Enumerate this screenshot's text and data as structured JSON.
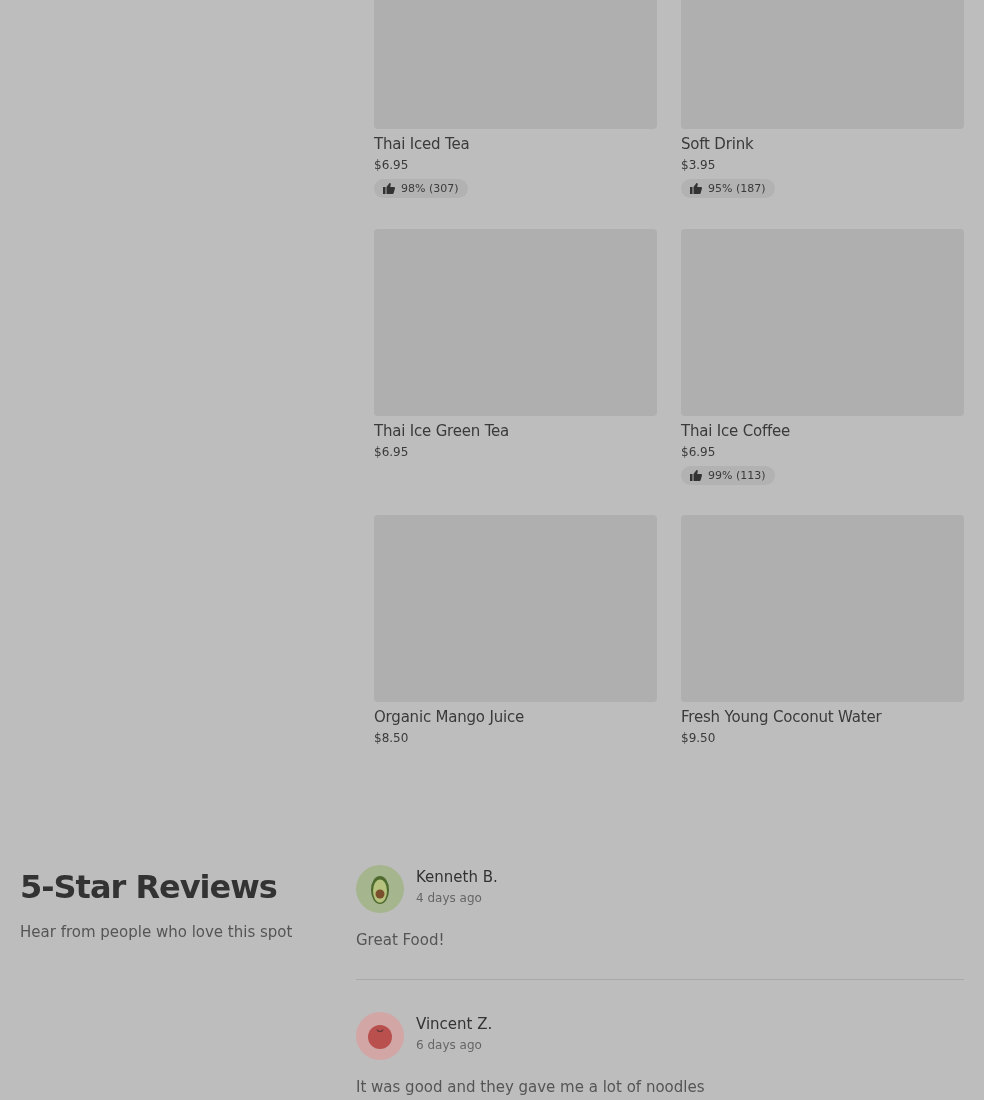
{
  "menu_items": [
    {
      "kind": "picture",
      "name": "Thai Iced Tea",
      "price": "$6.95",
      "rating": "98% (307)"
    },
    {
      "kind": "picture",
      "name": "Soft Drink",
      "price": "$3.95",
      "rating": "95% (187)"
    },
    {
      "kind": "picture",
      "name": "Thai Ice Green Tea",
      "price": "$6.95"
    },
    {
      "kind": "picture",
      "name": "Thai Ice Coffee",
      "price": "$6.95",
      "rating": "99% (113)"
    },
    {
      "kind": "picture",
      "name": "Organic Mango Juice",
      "price": "$8.50"
    },
    {
      "kind": "picture",
      "name": "Fresh Young Coconut Water",
      "price": "$9.50"
    }
  ],
  "reviews_section": {
    "title": "5-Star Reviews",
    "subtitle": "Hear from people who love this spot"
  },
  "reviews": [
    {
      "kind": "avocado",
      "name": "Kenneth B.",
      "time": "4 days ago",
      "text": "Great Food!"
    },
    {
      "kind": "tomato",
      "name": "Vincent Z.",
      "time": "6 days ago",
      "text": "It was good and they gave me a lot of noodles"
    }
  ]
}
